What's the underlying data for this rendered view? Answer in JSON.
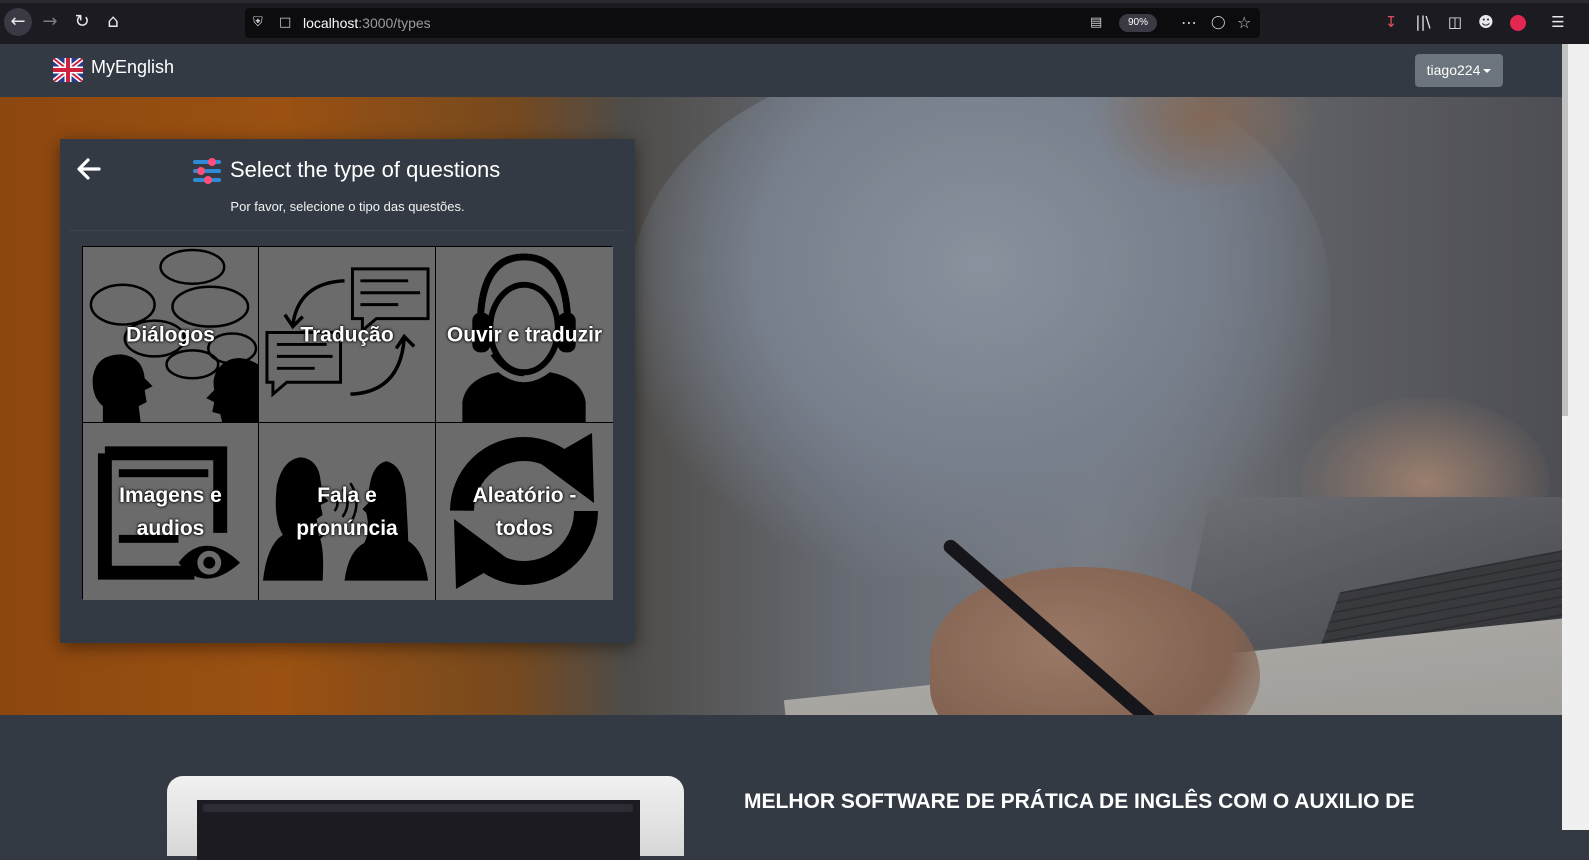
{
  "browser": {
    "url_host": "localhost",
    "url_path": ":3000/types",
    "zoom": "90%"
  },
  "navbar": {
    "brand": "MyEnglish",
    "user": "tiago224"
  },
  "card": {
    "title": "Select the type of questions",
    "subtitle": "Por favor, selecione o tipo das questões.",
    "tiles": [
      {
        "label": "Diálogos",
        "icon": "dialog-icon"
      },
      {
        "label": "Tradução",
        "icon": "translation-icon"
      },
      {
        "label": "Ouvir e traduzir",
        "icon": "headphones-icon"
      },
      {
        "label": "Imagens e audios",
        "icon": "image-eye-icon"
      },
      {
        "label": "Fala e pronúncia",
        "icon": "speech-icon"
      },
      {
        "label": "Aleatório - todos",
        "icon": "refresh-icon"
      }
    ]
  },
  "lower": {
    "heading": "MELHOR SOFTWARE DE PRÁTICA DE INGLÊS COM O AUXILIO DE"
  },
  "colors": {
    "navbar": "#343a44",
    "tile": "#6b6b6b",
    "user_button": "#6c757d",
    "browser_chrome": "#1c1b22"
  }
}
